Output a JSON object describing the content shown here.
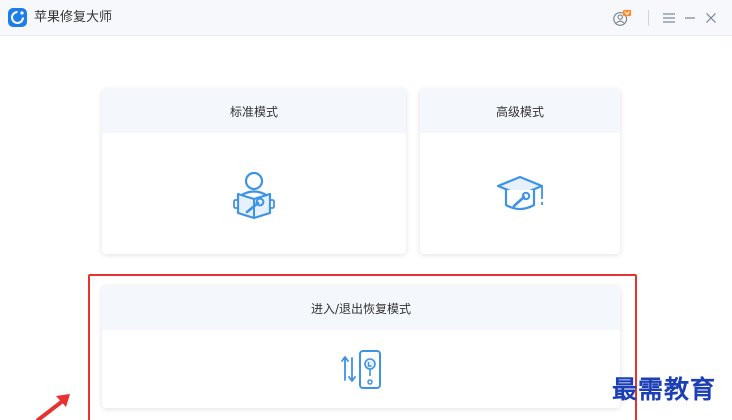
{
  "window": {
    "title": "苹果修复大师"
  },
  "titlebar": {
    "user_icon": "user-vip-icon",
    "menu_icon": "menu-icon",
    "minimize_icon": "minimize-icon",
    "close_icon": "close-icon"
  },
  "modes": {
    "standard": {
      "label": "标准模式",
      "icon": "person-repair-icon"
    },
    "advanced": {
      "label": "高级模式",
      "icon": "graduation-cap-icon"
    },
    "recovery": {
      "label": "进入/退出恢复模式",
      "icon": "phone-arrows-icon"
    }
  },
  "overlay": {
    "watermark": "最需教育"
  },
  "colors": {
    "accent": "#3d93e8",
    "highlight": "#e8322f",
    "watermark": "#1d3fb5"
  }
}
